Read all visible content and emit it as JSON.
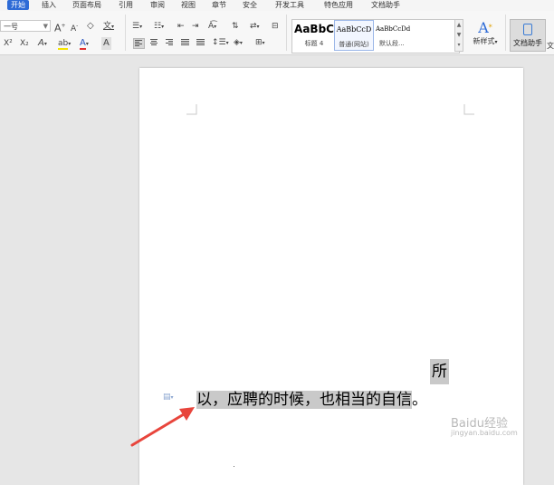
{
  "menu": {
    "items": [
      "开始",
      "插入",
      "页面布局",
      "引用",
      "审阅",
      "视图",
      "章节",
      "安全",
      "开发工具",
      "特色应用",
      "文档助手"
    ]
  },
  "toolbar": {
    "font_name": "一号",
    "grow_font": "A",
    "shrink_font": "A",
    "clear_format": "◇",
    "pinyin": "文",
    "superscript": "X²",
    "subscript": "X₂",
    "text_effect": "A",
    "highlight": "ab",
    "font_color": "A",
    "char_shading": "A",
    "styles": [
      {
        "sample": "AaBbC",
        "caption": "标题 4"
      },
      {
        "sample": "AaBbCcD",
        "caption": "普通(网站)"
      },
      {
        "sample": "AaBbCcDd",
        "caption": "默认段..."
      }
    ],
    "new_style_label": "新样式",
    "doc_assistant_label": "文档助手",
    "more_label": "文"
  },
  "document": {
    "line1": "所",
    "line2_selected": "以，应聘的时候，也相当的自信",
    "line2_end": "。"
  },
  "watermark": {
    "brand": "Baidu经验",
    "url": "jingyan.baidu.com"
  },
  "colors": {
    "accent": "#2e6bd6",
    "highlight": "#c9c9c9",
    "arrow": "#e8453c",
    "font_color_bar": "#e03030",
    "highlight_bar": "#f5e400"
  }
}
